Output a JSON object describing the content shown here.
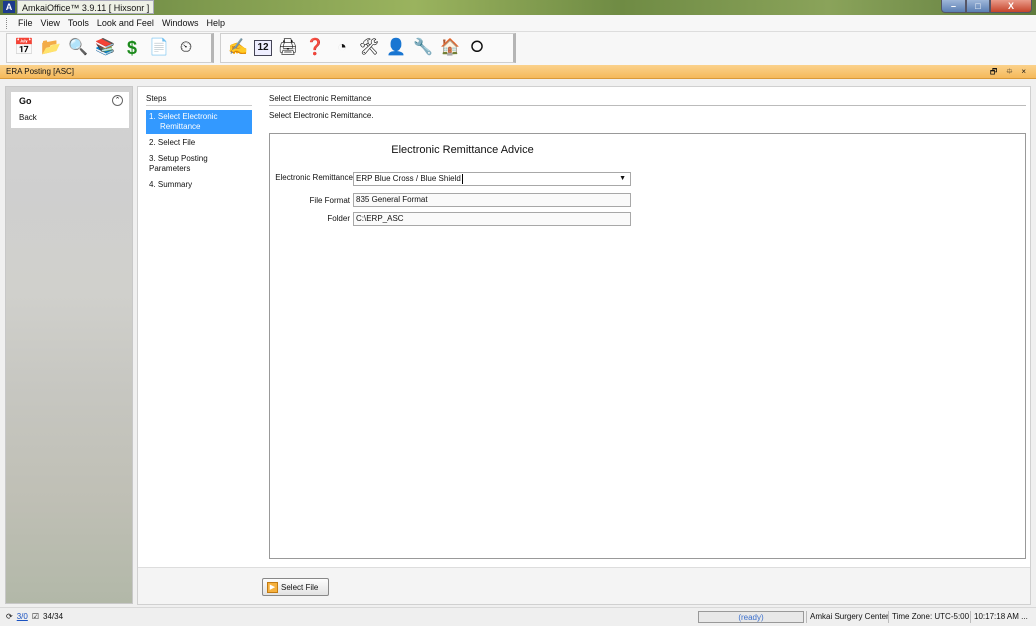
{
  "window": {
    "title": "AmkaiOffice™ 3.9.11 [ Hixsonr ]",
    "app_icon": "A",
    "buttons": {
      "minimize": "–",
      "maximize": "□",
      "close": "X"
    }
  },
  "menu": {
    "items": [
      "File",
      "View",
      "Tools",
      "Look and Feel",
      "Windows",
      "Help"
    ]
  },
  "toolbar": {
    "group1": [
      {
        "name": "calendar-icon",
        "glyph": "📅"
      },
      {
        "name": "folders-icon",
        "glyph": "📂"
      },
      {
        "name": "search-documents-icon",
        "glyph": "🔍"
      },
      {
        "name": "books-icon",
        "glyph": "📚"
      },
      {
        "name": "dollar-icon",
        "glyph": "$"
      },
      {
        "name": "notepad-icon",
        "glyph": "📄"
      },
      {
        "name": "monitor-icon",
        "glyph": "⏲"
      }
    ],
    "group2": [
      {
        "name": "signature-icon",
        "glyph": "✍"
      },
      {
        "name": "calendar-12-icon",
        "glyph": "12"
      },
      {
        "name": "scanner-icon",
        "glyph": "🖨"
      },
      {
        "name": "help-folder-icon",
        "glyph": "❓"
      },
      {
        "name": "pie-chart-icon",
        "glyph": "◔"
      },
      {
        "name": "tools-icon",
        "glyph": "🛠"
      },
      {
        "name": "person-icon",
        "glyph": "👤"
      },
      {
        "name": "wrench-icon",
        "glyph": "🔧"
      },
      {
        "name": "org-chart-icon",
        "glyph": "🏠"
      },
      {
        "name": "lifebuoy-icon",
        "glyph": "⭘"
      }
    ]
  },
  "doc_tab": {
    "title": "ERA Posting [ASC]",
    "controls": [
      "🗗",
      "⯐",
      "×"
    ]
  },
  "left_panel": {
    "go_label": "Go",
    "collapse_glyph": "⌃",
    "back_label": "Back"
  },
  "steps": {
    "title": "Steps",
    "items": [
      {
        "label": "1. Select Electronic",
        "label2": "Remittance"
      },
      {
        "label": "2. Select File"
      },
      {
        "label": "3. Setup Posting Parameters"
      },
      {
        "label": "4. Summary"
      }
    ]
  },
  "content": {
    "section_title": "Select Electronic Remittance",
    "section_desc": "Select Electronic Remittance.",
    "form_title": "Electronic Remittance Advice",
    "fields": {
      "remittance_label": "Electronic Remittance",
      "remittance_value": "ERP Blue Cross / Blue Shield",
      "format_label": "File Format",
      "format_value": "835 General Format",
      "folder_label": "Folder",
      "folder_value": "C:\\ERP_ASC"
    },
    "dropdown_arrow": "▼"
  },
  "actions": {
    "select_file_label": "Select File"
  },
  "status": {
    "counter_changes": "3/0",
    "counter_total": "34/34",
    "progress_text": "(ready)",
    "facility": "Amkai Surgery Center",
    "timezone": "Time Zone: UTC-5:00",
    "time": "10:17:18 AM ..."
  },
  "colors": {
    "accent": "#3399ff",
    "tab_header": "#f5b95b",
    "title_bar": "#7f9a4e"
  }
}
